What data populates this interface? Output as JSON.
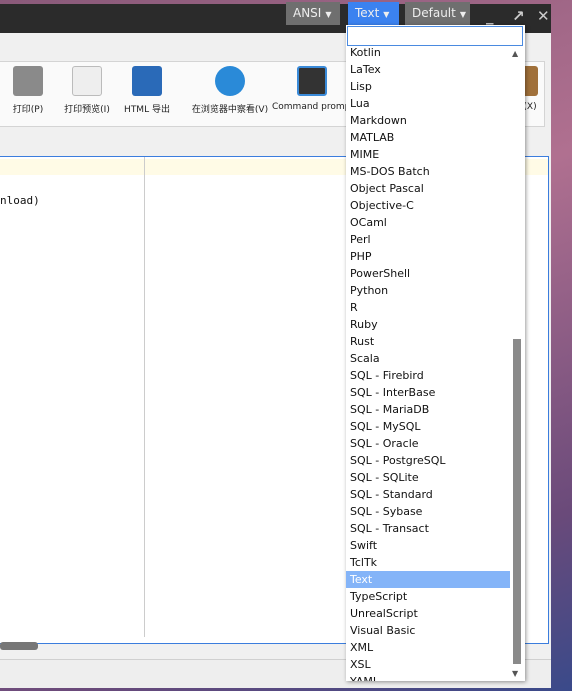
{
  "titlebar": {
    "encoding": "ANSI",
    "language": "Text",
    "theme": "Default",
    "accent": "#3b82f0"
  },
  "toolbar": {
    "items": [
      {
        "label": "打印(P)",
        "icon": "printer-icon"
      },
      {
        "label": "打印预览(I)",
        "icon": "print-preview-icon"
      },
      {
        "label": "HTML 导出",
        "icon": "html-export-icon"
      },
      {
        "label": "在浏览器中察看(V)",
        "icon": "browser-globe-icon"
      },
      {
        "label": "Command prompt",
        "icon": "terminal-icon"
      },
      {
        "label": "(X)",
        "icon": "exit-door-icon"
      }
    ]
  },
  "editor": {
    "code_fragment": "nload)"
  },
  "dropdown": {
    "search_value": "",
    "items": [
      "Kotlin",
      "LaTex",
      "Lisp",
      "Lua",
      "Markdown",
      "MATLAB",
      "MIME",
      "MS-DOS Batch",
      "Object Pascal",
      "Objective-C",
      "OCaml",
      "Perl",
      "PHP",
      "PowerShell",
      "Python",
      "R",
      "Ruby",
      "Rust",
      "Scala",
      "SQL - Firebird",
      "SQL - InterBase",
      "SQL - MariaDB",
      "SQL - MySQL",
      "SQL - Oracle",
      "SQL - PostgreSQL",
      "SQL - SQLite",
      "SQL - Standard",
      "SQL - Sybase",
      "SQL - Transact",
      "Swift",
      "TclTk",
      "Text",
      "TypeScript",
      "UnrealScript",
      "Visual Basic",
      "XML",
      "XSL",
      "YAML"
    ],
    "selected": "Text"
  }
}
